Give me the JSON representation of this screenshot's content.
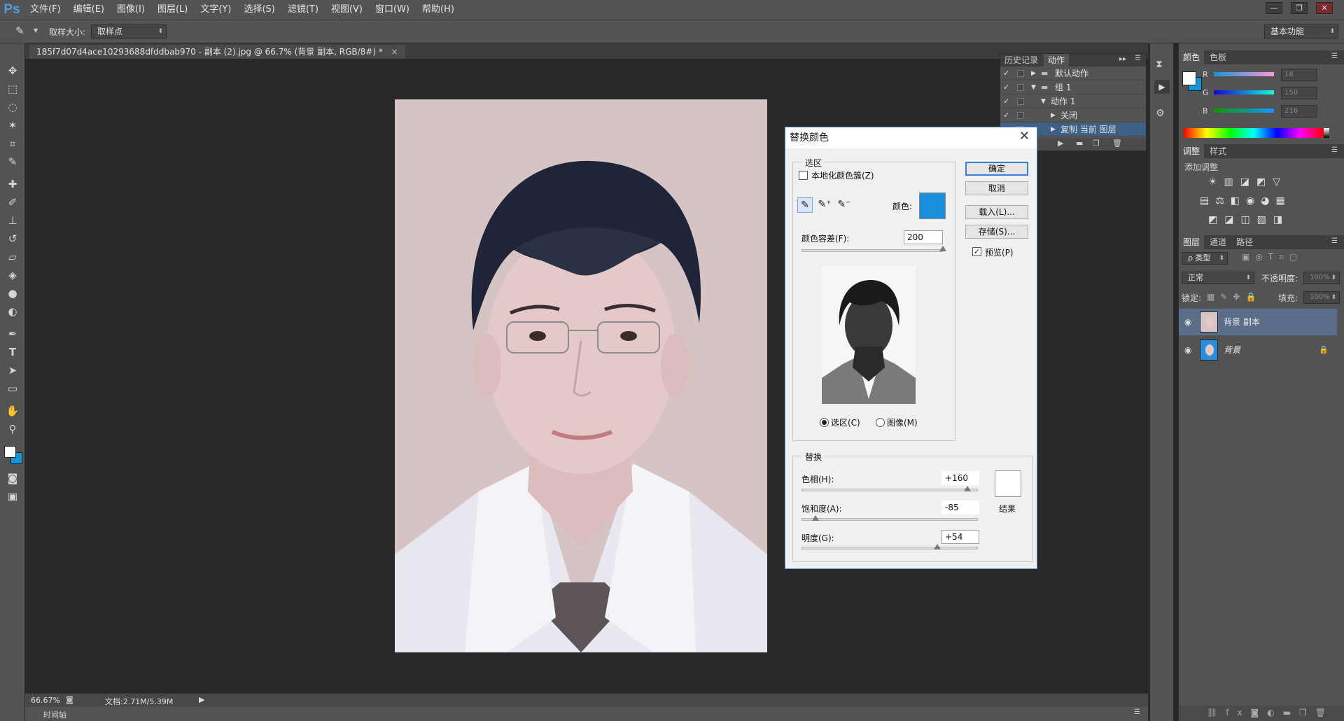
{
  "app": {
    "logo": "Ps",
    "menu": [
      "文件(F)",
      "编辑(E)",
      "图像(I)",
      "图层(L)",
      "文字(Y)",
      "选择(S)",
      "滤镜(T)",
      "视图(V)",
      "窗口(W)",
      "帮助(H)"
    ],
    "window_controls": [
      "—",
      "❐",
      "✕"
    ]
  },
  "options_bar": {
    "sample_size_label": "取样大小:",
    "sample_size_value": "取样点",
    "workspace": "基本功能"
  },
  "document": {
    "tab_title": "185f7d07d4ace10293688dfddbab970 - 副本 (2).jpg @ 66.7% (背景 副本, RGB/8#) *",
    "tab_close": "×"
  },
  "status": {
    "zoom": "66.67%",
    "doc_size": "文档:2.71M/5.39M",
    "timeline": "时间轴"
  },
  "actions_panel": {
    "tabs": [
      "历史记录",
      "动作"
    ],
    "active_tab": "动作",
    "rows": [
      {
        "label": "默认动作",
        "indent": 0,
        "folder": true,
        "expanded": false
      },
      {
        "label": "组 1",
        "indent": 0,
        "folder": true,
        "expanded": true
      },
      {
        "label": "动作 1",
        "indent": 1,
        "folder": false,
        "expanded": true
      },
      {
        "label": "关闭",
        "indent": 2,
        "folder": false,
        "expanded": false
      },
      {
        "label": "复制 当前 图层",
        "indent": 2,
        "folder": false,
        "expanded": false
      }
    ]
  },
  "dialog": {
    "title": "替换颜色",
    "selection_group": "选区",
    "localized_clusters": "本地化颜色簇(Z)",
    "color_label": "颜色:",
    "selection_color": "#1a8fdc",
    "fuzziness_label": "颜色容差(F):",
    "fuzziness_value": "200",
    "fuzziness_level": 1.0,
    "radio_selection": "选区(C)",
    "radio_image": "图像(M)",
    "replace_group": "替换",
    "hue_label": "色相(H):",
    "hue_value": "+160",
    "hue_level": 0.94,
    "saturation_label": "饱和度(A):",
    "saturation_value": "-85",
    "saturation_level": 0.08,
    "lightness_label": "明度(G):",
    "lightness_value": "+54",
    "lightness_level": 0.77,
    "result_label": "结果",
    "result_color": "#ffffff",
    "buttons": {
      "ok": "确定",
      "cancel": "取消",
      "load": "载入(L)...",
      "save": "存储(S)..."
    },
    "preview_label": "预览(P)",
    "preview_checked": true
  },
  "color_panel": {
    "tabs": [
      "颜色",
      "色板"
    ],
    "channels": [
      {
        "name": "R",
        "value": "18"
      },
      {
        "name": "G",
        "value": "150"
      },
      {
        "name": "B",
        "value": "216"
      }
    ],
    "foreground": "#ffffff",
    "background": "#1296d8"
  },
  "adjustments_panel": {
    "tabs": [
      "调整",
      "样式"
    ],
    "add_label": "添加调整"
  },
  "layers_panel": {
    "tabs": [
      "图层",
      "通道",
      "路径"
    ],
    "filter_kind": "ρ 类型",
    "blend_mode": "正常",
    "opacity_label": "不透明度:",
    "opacity_value": "100%",
    "lock_label": "锁定:",
    "fill_label": "填充:",
    "fill_value": "100%",
    "layers": [
      {
        "name": "背景 副本",
        "selected": true,
        "locked": false
      },
      {
        "name": "背景",
        "selected": false,
        "locked": true
      }
    ]
  }
}
